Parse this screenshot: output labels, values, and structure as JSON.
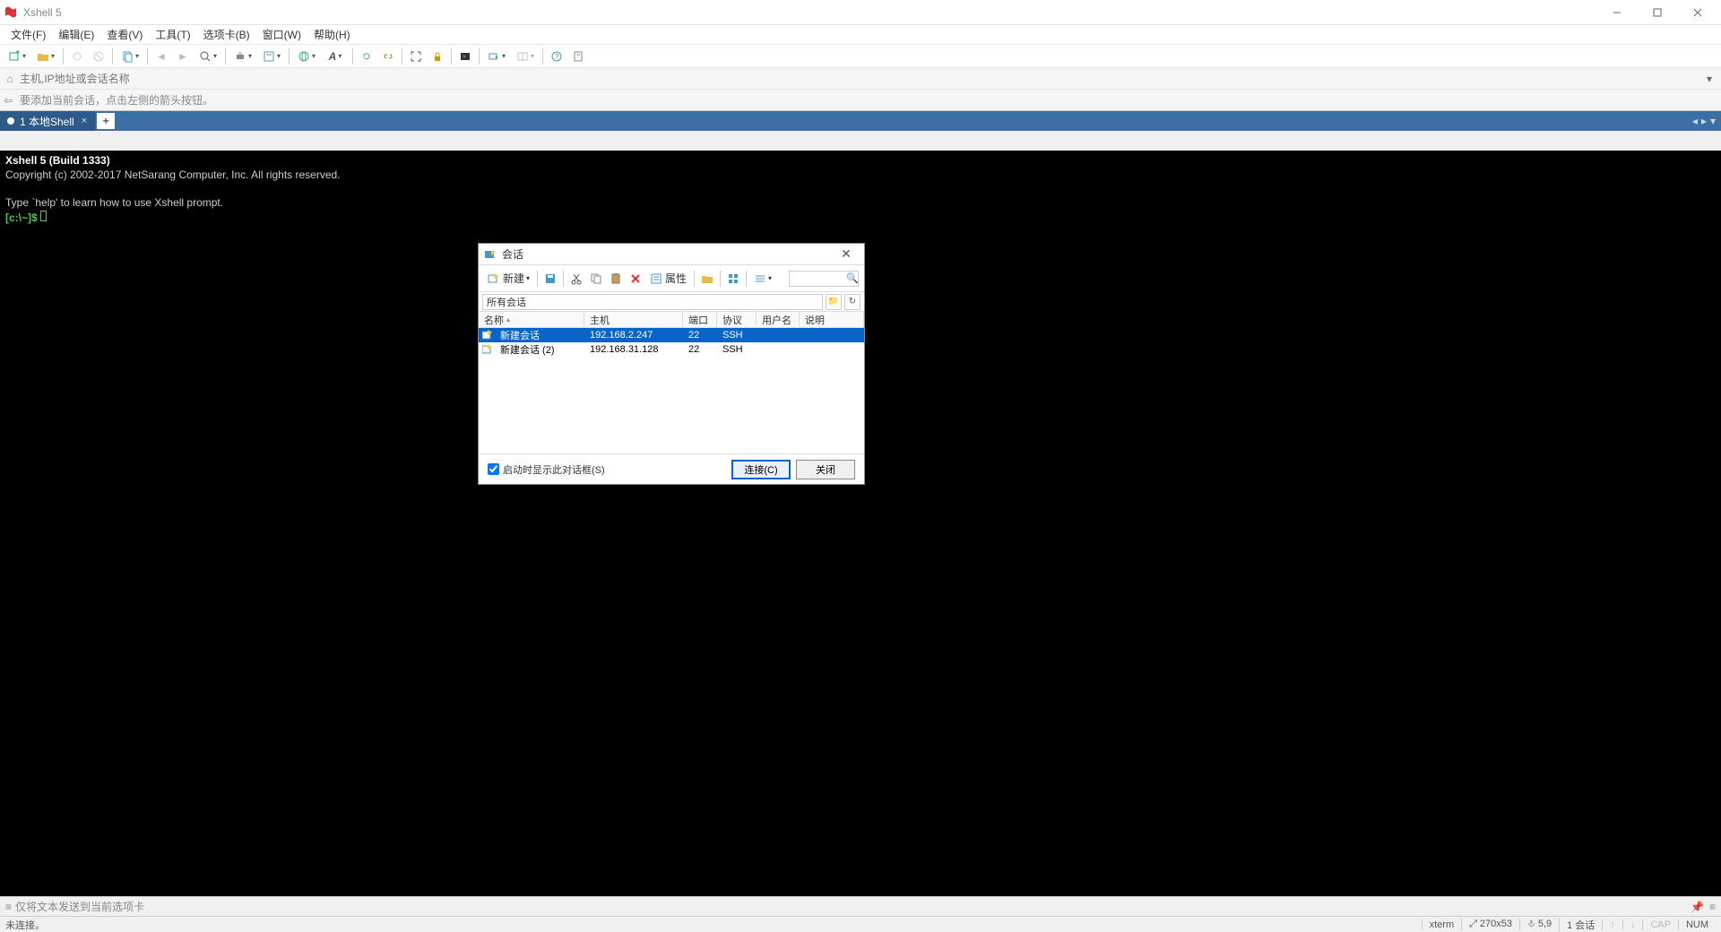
{
  "app": {
    "title": "Xshell 5"
  },
  "menu": [
    "文件(F)",
    "编辑(E)",
    "查看(V)",
    "工具(T)",
    "选项卡(B)",
    "窗口(W)",
    "帮助(H)"
  ],
  "addressbar": {
    "placeholder": "主机,IP地址或会话名称"
  },
  "hint": "要添加当前会话，点击左侧的箭头按钮。",
  "tabs": {
    "active": "1 本地Shell"
  },
  "terminal": {
    "line1": "Xshell 5 (Build 1333)",
    "line2": "Copyright (c) 2002-2017 NetSarang Computer, Inc. All rights reserved.",
    "line3": "",
    "line4": "Type `help' to learn how to use Xshell prompt.",
    "prompt": "[c:\\~]$ "
  },
  "dialog": {
    "title": "会话",
    "new_label": "新建",
    "props_label": "属性",
    "path": "所有会话",
    "cols": {
      "name": "名称",
      "host": "主机",
      "port": "端口",
      "proto": "协议",
      "user": "用户名",
      "desc": "说明"
    },
    "rows": [
      {
        "name": "新建会话",
        "host": "192.168.2.247",
        "port": "22",
        "proto": "SSH",
        "user": "",
        "desc": ""
      },
      {
        "name": "新建会话 (2)",
        "host": "192.168.31.128",
        "port": "22",
        "proto": "SSH",
        "user": "",
        "desc": ""
      }
    ],
    "startup_label": "启动时显示此对话框(S)",
    "connect": "连接(C)",
    "close": "关闭"
  },
  "bottombar": {
    "msg": "仅将文本发送到当前选项卡"
  },
  "status": {
    "left": "未连接。",
    "term": "xterm",
    "size": "270x53",
    "pos": "5,9",
    "sess": "1 会话",
    "cap": "CAP",
    "num": "NUM"
  }
}
